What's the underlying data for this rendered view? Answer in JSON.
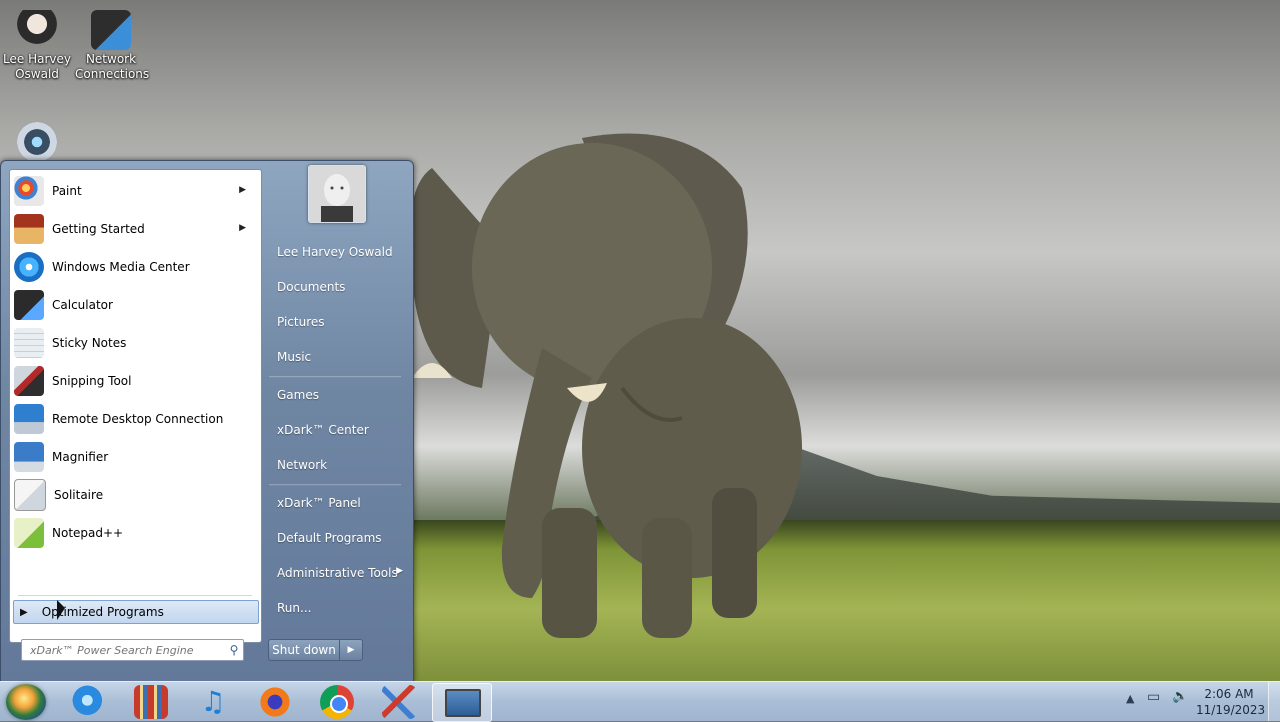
{
  "desktop": {
    "icons": [
      {
        "label": "Lee Harvey Oswald",
        "icon": "user-folder-icon"
      },
      {
        "label": "Network Connections",
        "icon": "network-icon"
      },
      {
        "label": "",
        "icon": "webcam-icon"
      }
    ]
  },
  "start_menu": {
    "programs": [
      {
        "label": "Paint",
        "icon": "paint-icon",
        "has_submenu": true
      },
      {
        "label": "Getting Started",
        "icon": "getting-started-icon",
        "has_submenu": true
      },
      {
        "label": "Windows Media Center",
        "icon": "media-center-icon",
        "has_submenu": false
      },
      {
        "label": "Calculator",
        "icon": "calculator-icon",
        "has_submenu": false
      },
      {
        "label": "Sticky Notes",
        "icon": "sticky-notes-icon",
        "has_submenu": false
      },
      {
        "label": "Snipping Tool",
        "icon": "snipping-tool-icon",
        "has_submenu": false
      },
      {
        "label": "Remote Desktop Connection",
        "icon": "remote-desktop-icon",
        "has_submenu": false
      },
      {
        "label": "Magnifier",
        "icon": "magnifier-icon",
        "has_submenu": false
      },
      {
        "label": "Solitaire",
        "icon": "solitaire-icon",
        "has_submenu": false
      },
      {
        "label": "Notepad++",
        "icon": "notepad-plus-plus-icon",
        "has_submenu": false
      }
    ],
    "all_programs_label": "Optimized Programs",
    "search_placeholder": "xDark™ Power Search Engine",
    "right_items": [
      {
        "label": "Lee Harvey Oswald"
      },
      {
        "label": "Documents"
      },
      {
        "label": "Pictures"
      },
      {
        "label": "Music"
      },
      {
        "label": "Games"
      },
      {
        "label": "xDark™ Center"
      },
      {
        "label": "Network"
      },
      {
        "label": "xDark™ Panel"
      },
      {
        "label": "Default Programs"
      },
      {
        "label": "Administrative Tools",
        "has_submenu": true
      },
      {
        "label": "Run..."
      }
    ],
    "shutdown_label": "Shut down"
  },
  "taskbar": {
    "pinned": [
      "internet-explorer-icon",
      "library-icon",
      "music-icon",
      "firefox-icon",
      "chrome-icon",
      "tools-icon",
      "remote-desktop-icon"
    ],
    "clock_time": "2:06 AM",
    "clock_date": "11/19/2023"
  },
  "colors": {
    "taskbar": "#aabed6",
    "start_menu": "#6f86a3",
    "selection": "#c2d6ef"
  }
}
